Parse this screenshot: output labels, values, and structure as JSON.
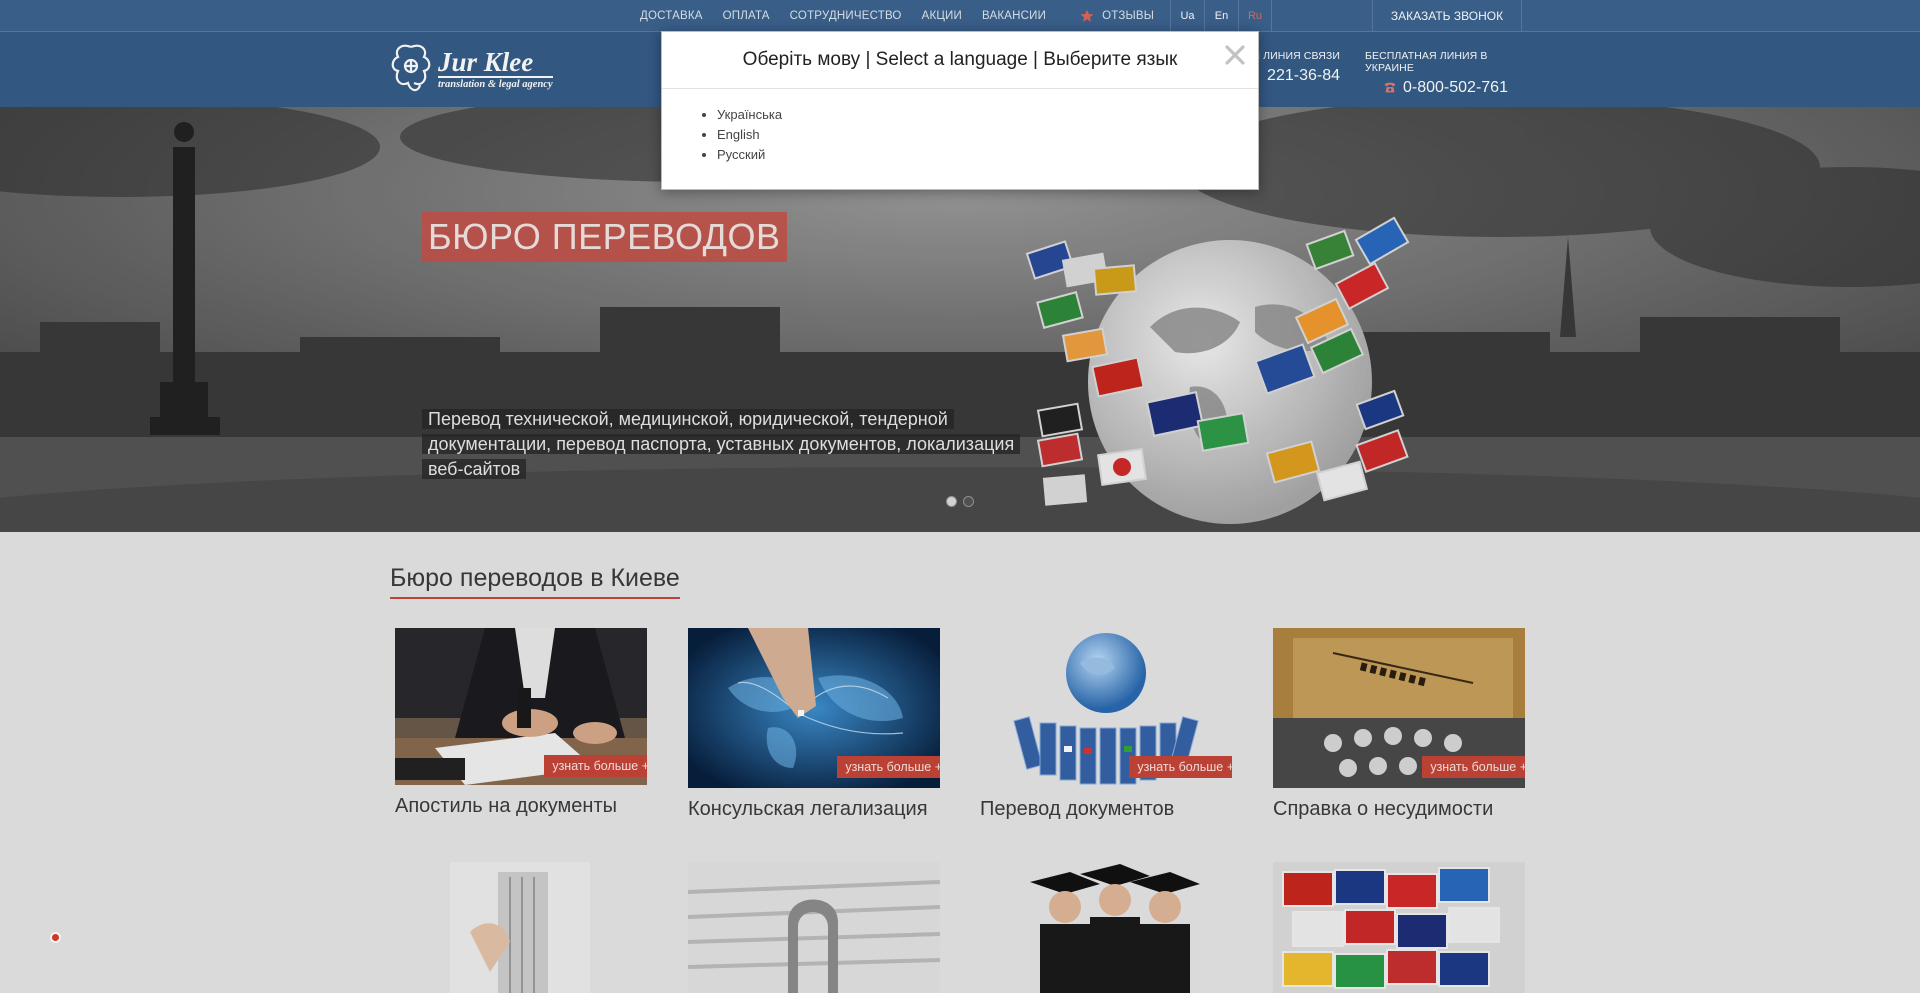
{
  "nav": {
    "links": [
      "ДОСТАВКА",
      "ОПЛАТА",
      "СОТРУДНИЧЕСТВО",
      "АКЦИИ",
      "ВАКАНСИИ"
    ],
    "reviews": "ОТЗЫВЫ",
    "reviews_icon": "star-icon",
    "languages": [
      "Ua",
      "En",
      "Ru"
    ],
    "call_button": "ЗАКАЗАТЬ ЗВОНОК"
  },
  "header": {
    "logo_name": "Jur Klee",
    "logo_tagline": "translation & legal agency",
    "hotline1_caption": "Я ЛИНИЯ СВЯЗИ",
    "hotline1_number": "221-36-84",
    "hotline2_caption": "БЕСПЛАТНАЯ ЛИНИЯ В УКРАИНЕ",
    "hotline2_number": "0-800-502-761",
    "phone_icon": "phone-icon"
  },
  "hero": {
    "title": "БЮРО ПЕРЕВОДОВ",
    "subtitle": "Перевод технической, медицинской, юридической, тендерной документации, перевод паспорта, уставных документов, локализация веб-сайтов",
    "slides": 2
  },
  "main": {
    "section_title": "Бюро переводов в Киеве",
    "more_label": "узнать больше +",
    "cards": [
      {
        "title": "Апостиль на документы"
      },
      {
        "title": "Консульская легализация"
      },
      {
        "title": "Перевод документов"
      },
      {
        "title": "Справка о несудимости"
      }
    ]
  },
  "modal": {
    "title": "Оберіть мову | Select a language | Выберите язык",
    "close_icon": "close-icon",
    "languages": [
      "Українська",
      "English",
      "Русский"
    ]
  },
  "colors": {
    "nav_bg": "#3d6490",
    "header_bg": "#355c88",
    "accent_red": "#c64538"
  }
}
